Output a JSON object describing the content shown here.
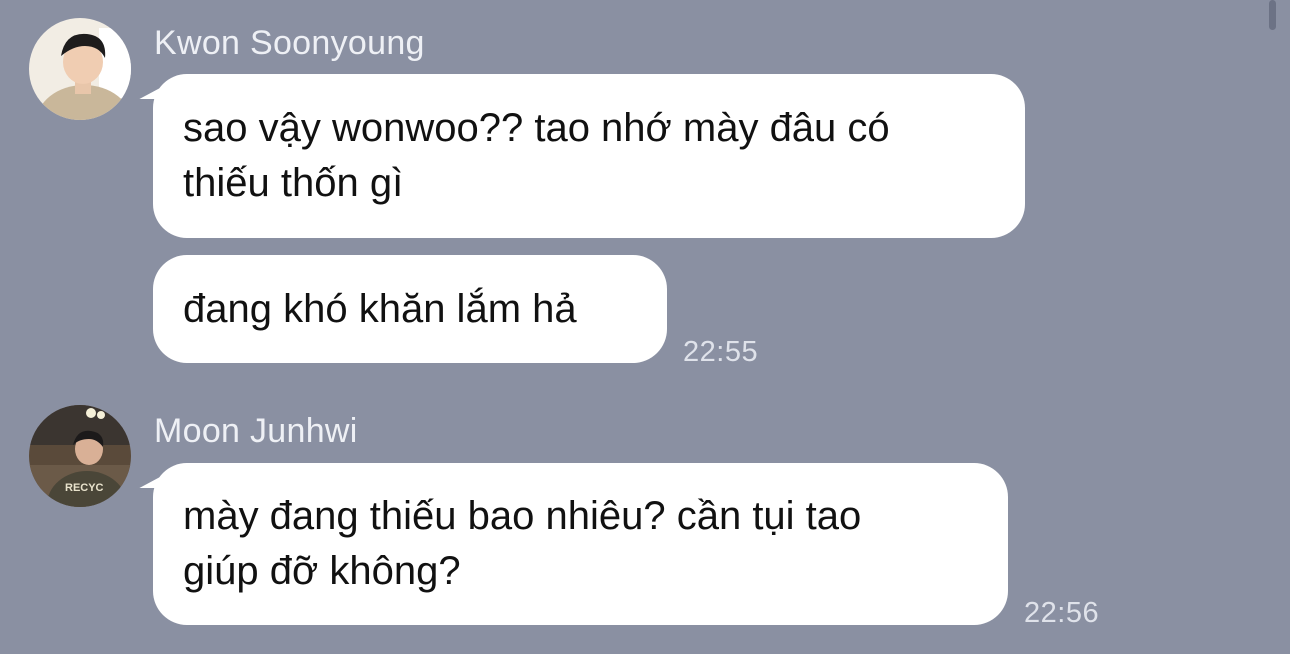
{
  "messages": [
    {
      "sender": "Kwon Soonyoung",
      "avatar_icon": "user-avatar-photo",
      "bubbles": [
        {
          "text_lines": [
            "sao vậy wonwoo?? tao nhớ mày đâu có",
            "thiếu thốn gì"
          ]
        },
        {
          "text_lines": [
            "đang khó khăn lắm hả"
          ]
        }
      ],
      "time": "22:55"
    },
    {
      "sender": "Moon Junhwi",
      "avatar_icon": "user-avatar-photo",
      "bubbles": [
        {
          "text_lines": [
            "mày đang thiếu bao nhiêu? cần tụi tao",
            "giúp đỡ không?"
          ]
        }
      ],
      "time": "22:56"
    }
  ],
  "colors": {
    "background": "#8a90a2",
    "bubble": "#ffffff",
    "sender_text": "#eef0f5",
    "timestamp_text": "#dfe2ea"
  }
}
